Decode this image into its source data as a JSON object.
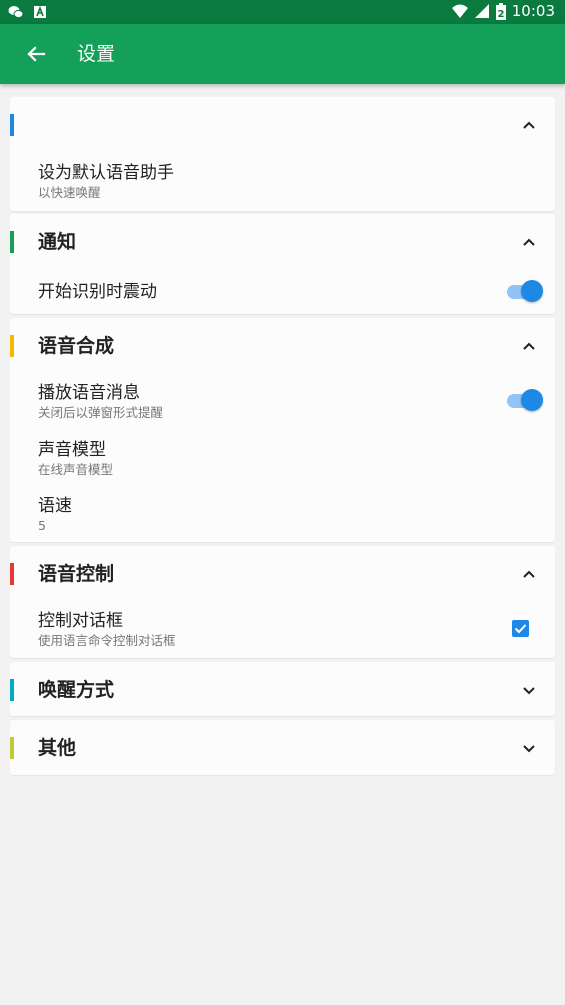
{
  "status_bar": {
    "time": "10:03",
    "battery_level": "2",
    "icons": [
      "wechat-icon",
      "notification-icon",
      "wifi-icon",
      "signal-icon",
      "battery-icon"
    ]
  },
  "app_bar": {
    "title": "设置",
    "back_icon": "arrow-back-icon"
  },
  "sections": [
    {
      "title": "",
      "accent": "#1e88e5",
      "expanded": true,
      "items": [
        {
          "title": "设为默认语音助手",
          "subtitle": "以快速唤醒"
        }
      ]
    },
    {
      "title": "通知",
      "accent": "#15a05a",
      "expanded": true,
      "items": [
        {
          "title": "开始识别时震动",
          "control": "toggle",
          "value": true
        }
      ]
    },
    {
      "title": "语音合成",
      "accent": "#f5b800",
      "expanded": true,
      "items": [
        {
          "title": "播放语音消息",
          "subtitle": "关闭后以弹窗形式提醒",
          "control": "toggle",
          "value": true
        },
        {
          "title": "声音模型",
          "subtitle": "在线声音模型"
        },
        {
          "title": "语速",
          "subtitle": "5"
        }
      ]
    },
    {
      "title": "语音控制",
      "accent": "#e53935",
      "expanded": true,
      "items": [
        {
          "title": "控制对话框",
          "subtitle": "使用语言命令控制对话框",
          "control": "checkbox",
          "value": true
        }
      ]
    },
    {
      "title": "唤醒方式",
      "accent": "#00acc1",
      "expanded": false,
      "items": []
    },
    {
      "title": "其他",
      "accent": "#c0ca33",
      "expanded": false,
      "items": []
    }
  ],
  "colors": {
    "status_bar": "#0a7a3f",
    "app_bar": "#15a05a",
    "control_active": "#1e88e5",
    "background": "#f2f2f2"
  }
}
